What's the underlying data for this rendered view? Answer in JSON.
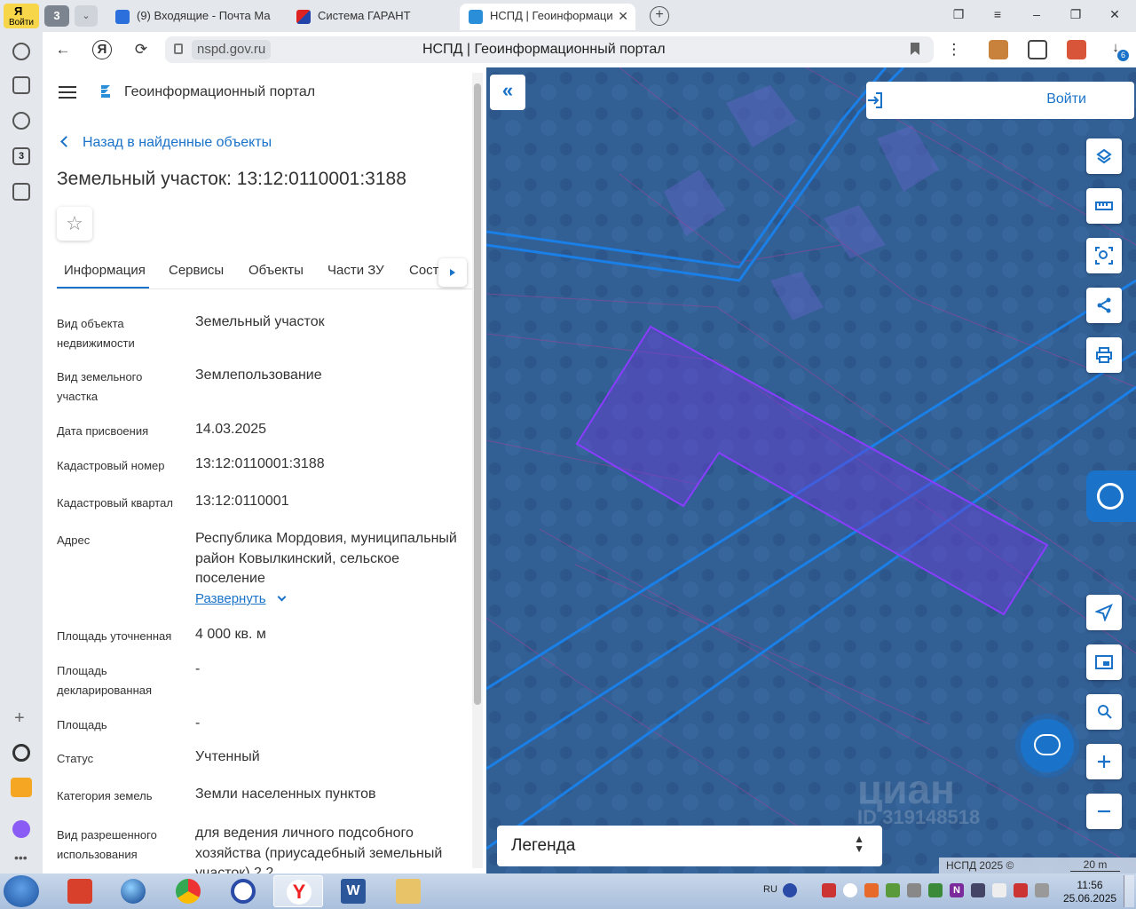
{
  "browser": {
    "login_label": "Войти",
    "tab_count": "3",
    "tabs": [
      {
        "title": "(9) Входящие - Почта Ма"
      },
      {
        "title": "Система ГАРАНТ"
      },
      {
        "title": "НСПД | Геоинформаци"
      }
    ],
    "url": "nspd.gov.ru",
    "page_title": "НСПД | Геоинформационный портал",
    "sidebar_badge": "3",
    "download_badge": "6"
  },
  "portal": {
    "app_title": "Геоинформационный портал",
    "back_label": "Назад в найденные объекты",
    "object_title": "Земельный участок: 13:12:0110001:3188",
    "tabs": [
      "Информация",
      "Сервисы",
      "Объекты",
      "Части ЗУ",
      "Соста"
    ],
    "expand_label": "Развернуть",
    "fields": [
      {
        "label": "Вид объекта недвижимости",
        "value": "Земельный участок"
      },
      {
        "label": "Вид земельного участка",
        "value": "Землепользование"
      },
      {
        "label": "Дата присвоения",
        "value": "14.03.2025"
      },
      {
        "label": "Кадастровый номер",
        "value": "13:12:0110001:3188"
      },
      {
        "label": "Кадастровый квартал",
        "value": "13:12:0110001"
      },
      {
        "label": "Адрес",
        "value": "Республика Мордовия, муниципальный район Ковылкинский, сельское поселение"
      },
      {
        "label": "Площадь уточненная",
        "value": "4 000 кв. м"
      },
      {
        "label": "Площадь декларированная",
        "value": "-"
      },
      {
        "label": "Площадь",
        "value": "-"
      },
      {
        "label": "Статус",
        "value": "Учтенный"
      },
      {
        "label": "Категория земель",
        "value": "Земли населенных пунктов"
      },
      {
        "label": "Вид разрешенного использования",
        "value": "для ведения личного подсобного хозяйства (приусадебный земельный участок) 2.2"
      }
    ]
  },
  "map": {
    "login_label": "Войти",
    "legend_label": "Легенда",
    "attribution": "НСПД 2025 ©",
    "scale_label": "20 m",
    "watermark": "циан",
    "watermark_id": "ID 319148518"
  },
  "taskbar": {
    "lang": "RU",
    "time": "11:56",
    "date": "25.06.2025"
  },
  "colors": {
    "accent": "#1a73c8",
    "parcel": "#7a3cff",
    "map_base": "#2f5f9a"
  }
}
